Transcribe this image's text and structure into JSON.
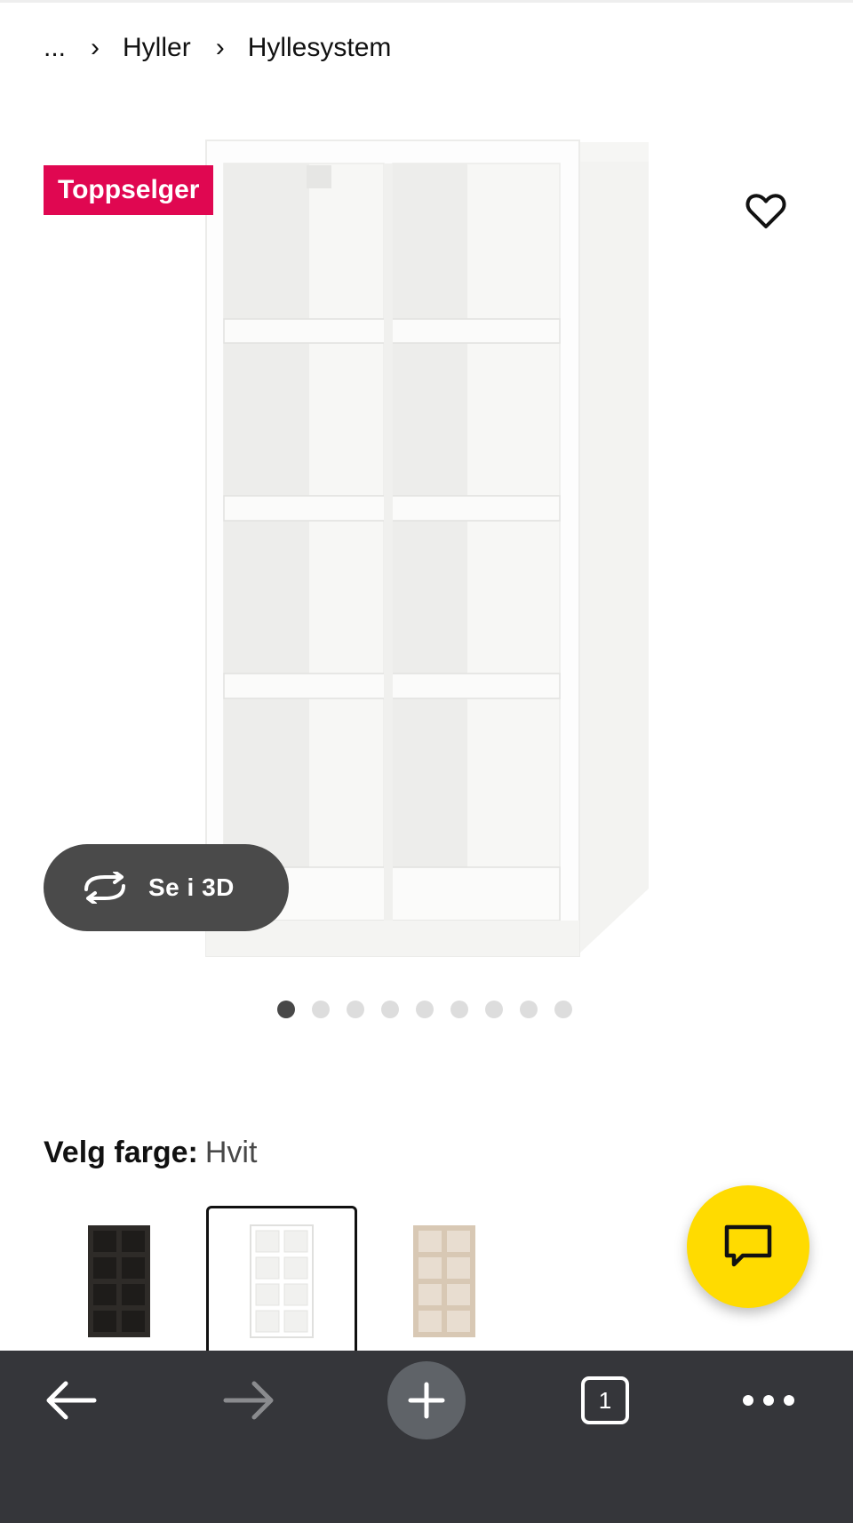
{
  "breadcrumb": {
    "ellipsis": "...",
    "items": [
      {
        "label": "Hyller"
      },
      {
        "label": "Hyllesystem"
      }
    ]
  },
  "product": {
    "badge": "Toppselger",
    "view_3d_label": "Se i 3D",
    "gallery": {
      "image_count": 9,
      "active_index": 0
    }
  },
  "color_picker": {
    "label": "Velg farge:",
    "selected": "Hvit",
    "options": [
      {
        "name": "black-brown",
        "color": "#2e2b28"
      },
      {
        "name": "white",
        "color": "#ffffff"
      },
      {
        "name": "white-stained-oak",
        "color": "#d8c8b4"
      }
    ]
  },
  "colors": {
    "badge": "#e00751",
    "chat": "#ffdb00",
    "button_3d": "#4a4a4a",
    "browser_bar": "#35363a"
  },
  "browser": {
    "tab_count": "1",
    "icons": [
      "back-arrow-icon",
      "forward-arrow-icon",
      "new-tab-plus-icon",
      "tab-switcher-icon",
      "more-menu-icon"
    ]
  }
}
